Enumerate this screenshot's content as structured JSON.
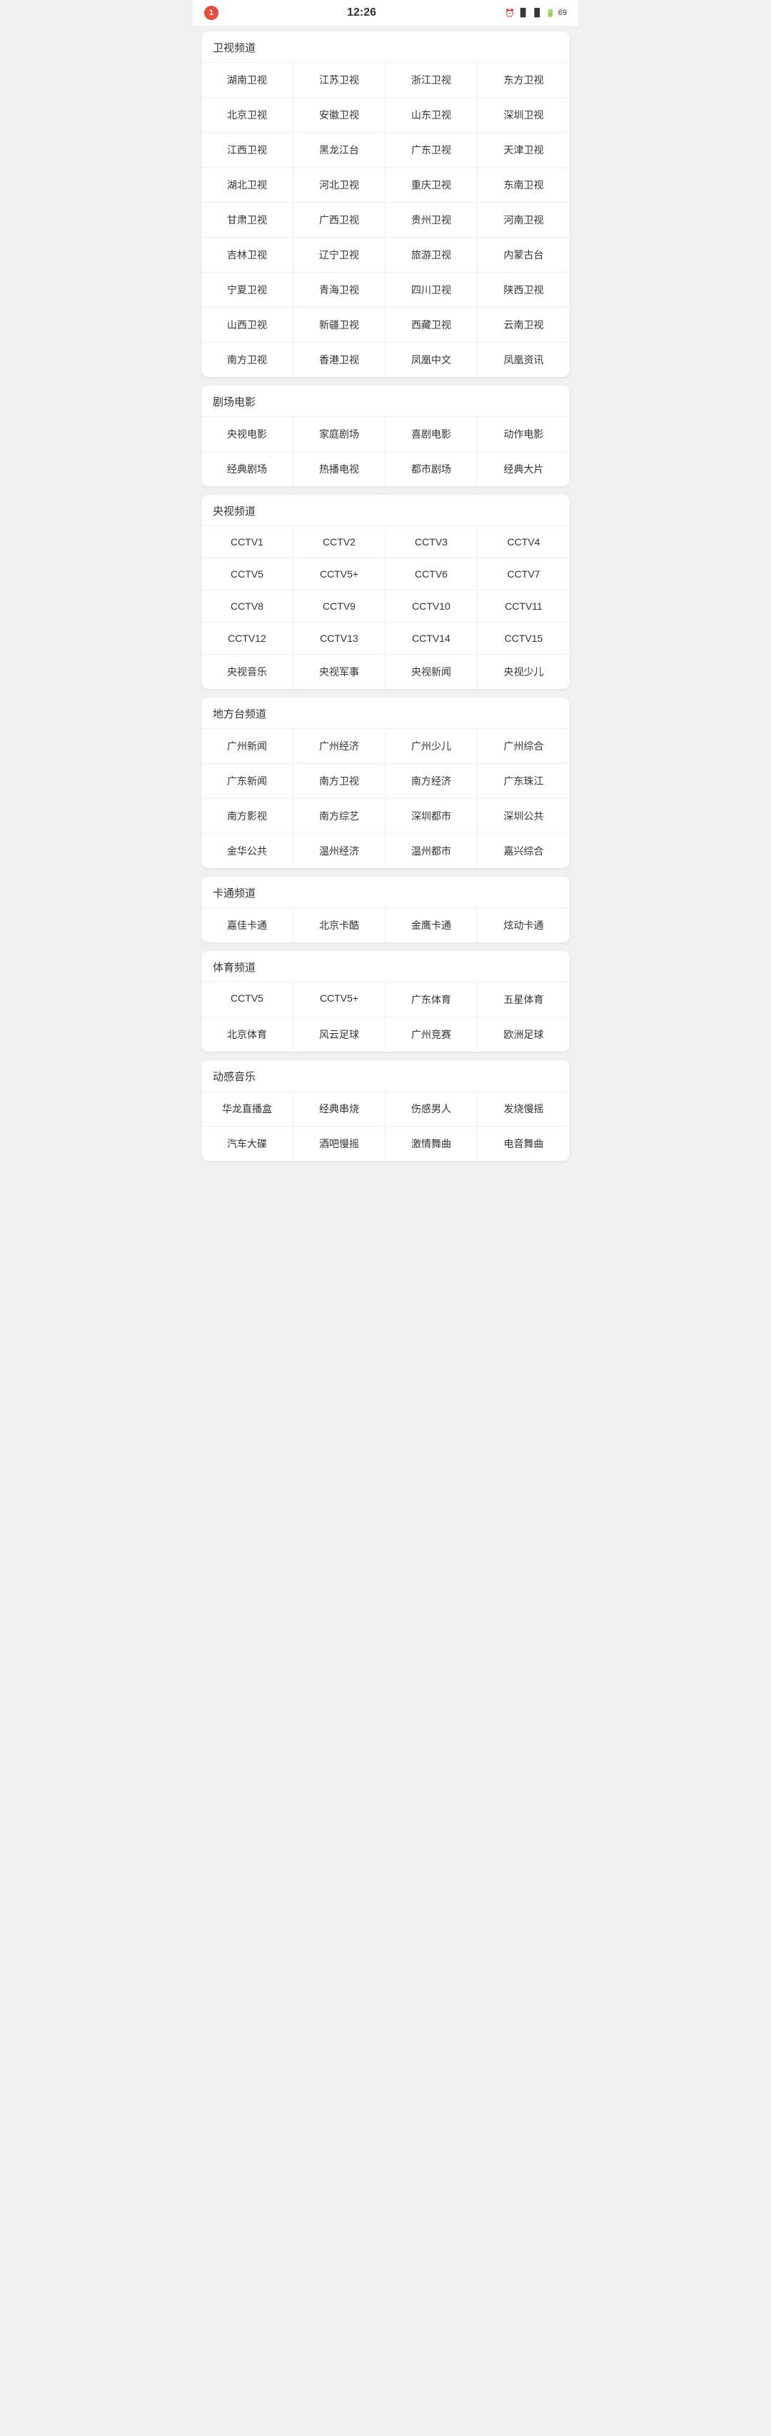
{
  "statusBar": {
    "notification": "1",
    "time": "12:26",
    "battery": "69",
    "signalIcon": "📶"
  },
  "sections": [
    {
      "id": "satellite",
      "title": "卫视频道",
      "items": [
        "湖南卫视",
        "江苏卫视",
        "浙江卫视",
        "东方卫视",
        "北京卫视",
        "安徽卫视",
        "山东卫视",
        "深圳卫视",
        "江西卫视",
        "黑龙江台",
        "广东卫视",
        "天津卫视",
        "湖北卫视",
        "河北卫视",
        "重庆卫视",
        "东南卫视",
        "甘肃卫视",
        "广西卫视",
        "贵州卫视",
        "河南卫视",
        "吉林卫视",
        "辽宁卫视",
        "旅游卫视",
        "内蒙古台",
        "宁夏卫视",
        "青海卫视",
        "四川卫视",
        "陕西卫视",
        "山西卫视",
        "新疆卫视",
        "西藏卫视",
        "云南卫视",
        "南方卫视",
        "香港卫视",
        "凤凰中文",
        "凤凰资讯"
      ]
    },
    {
      "id": "theater",
      "title": "剧场电影",
      "items": [
        "央视电影",
        "家庭剧场",
        "喜剧电影",
        "动作电影",
        "经典剧场",
        "热播电视",
        "都市剧场",
        "经典大片"
      ]
    },
    {
      "id": "cctv",
      "title": "央视频道",
      "items": [
        "CCTV1",
        "CCTV2",
        "CCTV3",
        "CCTV4",
        "CCTV5",
        "CCTV5+",
        "CCTV6",
        "CCTV7",
        "CCTV8",
        "CCTV9",
        "CCTV10",
        "CCTV11",
        "CCTV12",
        "CCTV13",
        "CCTV14",
        "CCTV15",
        "央视音乐",
        "央视军事",
        "央视新闻",
        "央视少儿"
      ]
    },
    {
      "id": "local",
      "title": "地方台频道",
      "items": [
        "广州新闻",
        "广州经济",
        "广州少儿",
        "广州综合",
        "广东新闻",
        "南方卫视",
        "南方经济",
        "广东珠江",
        "南方影视",
        "南方综艺",
        "深圳都市",
        "深圳公共",
        "金华公共",
        "温州经济",
        "温州都市",
        "嘉兴综合"
      ]
    },
    {
      "id": "cartoon",
      "title": "卡通频道",
      "items": [
        "嘉佳卡通",
        "北京卡酷",
        "金鹰卡通",
        "炫动卡通"
      ]
    },
    {
      "id": "sports",
      "title": "体育频道",
      "items": [
        "CCTV5",
        "CCTV5+",
        "广东体育",
        "五星体育",
        "北京体育",
        "风云足球",
        "广州竞赛",
        "欧洲足球"
      ]
    },
    {
      "id": "music",
      "title": "动感音乐",
      "items": [
        "华龙直播盒",
        "经典串烧",
        "伤感男人",
        "发烧慢摇",
        "汽车大碟",
        "酒吧慢摇",
        "激情舞曲",
        "电音舞曲"
      ]
    }
  ]
}
